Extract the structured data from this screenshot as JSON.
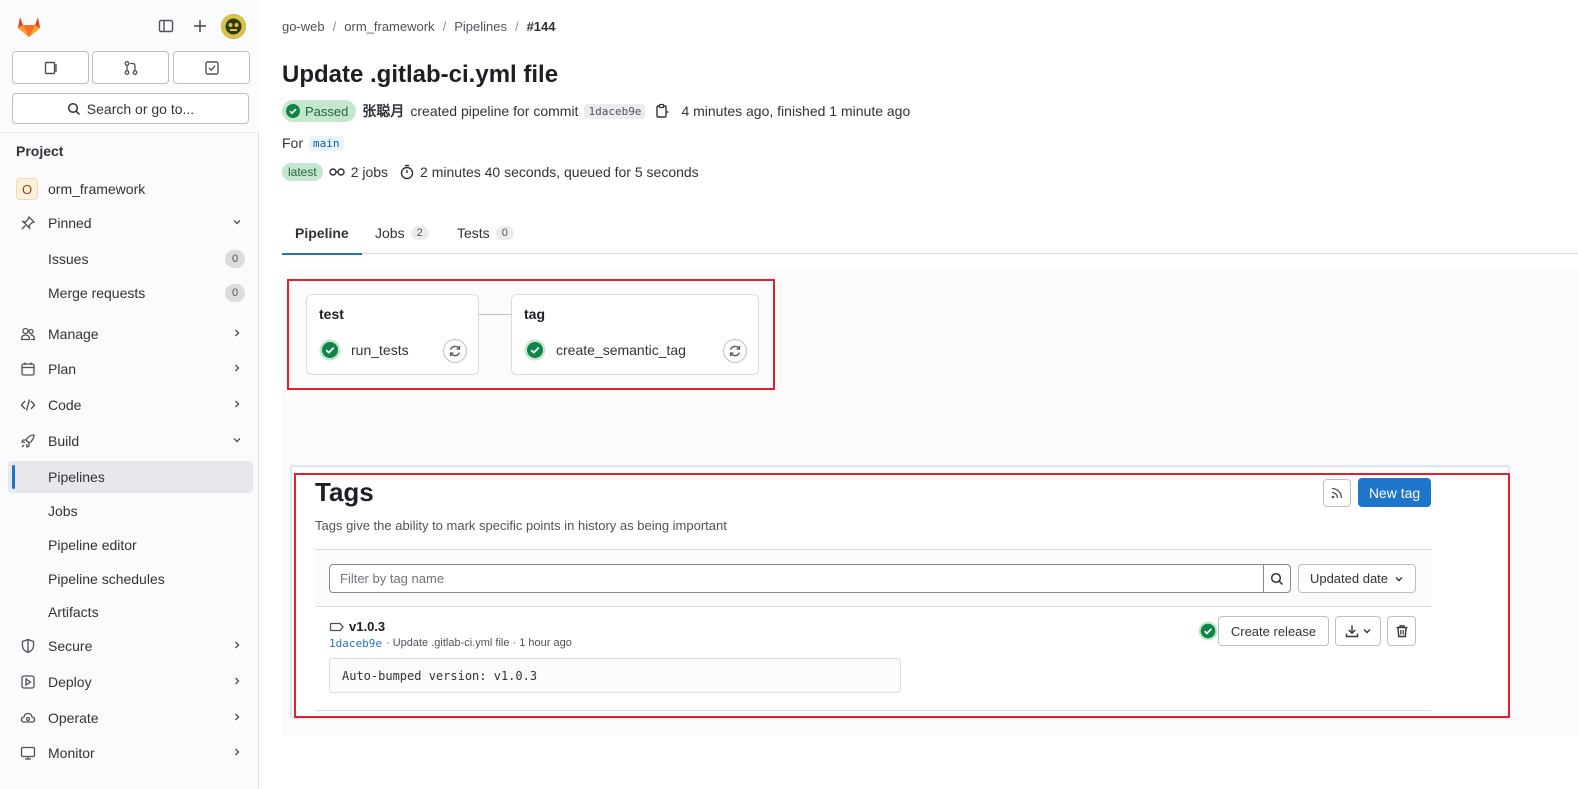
{
  "sidebar": {
    "search_label": "Search or go to...",
    "section_title": "Project",
    "project_initial": "O",
    "project_name": "orm_framework",
    "pinned_label": "Pinned",
    "issues_label": "Issues",
    "issues_count": "0",
    "mr_label": "Merge requests",
    "mr_count": "0",
    "manage": "Manage",
    "plan": "Plan",
    "code": "Code",
    "build": "Build",
    "pipelines": "Pipelines",
    "jobs": "Jobs",
    "pipeline_editor": "Pipeline editor",
    "pipeline_schedules": "Pipeline schedules",
    "artifacts": "Artifacts",
    "secure": "Secure",
    "deploy": "Deploy",
    "operate": "Operate",
    "monitor": "Monitor"
  },
  "breadcrumb": {
    "group": "go-web",
    "project": "orm_framework",
    "section": "Pipelines",
    "current": "#144"
  },
  "pipeline": {
    "title": "Update .gitlab-ci.yml file",
    "status": "Passed",
    "author": "张聪月",
    "created_text": "created pipeline for commit",
    "commit_sha": "1daceb9e",
    "time_text": "4 minutes ago, finished 1 minute ago",
    "for_label": "For",
    "branch": "main",
    "latest_badge": "latest",
    "jobs_count_text": "2 jobs",
    "duration_text": "2 minutes 40 seconds, queued for 5 seconds"
  },
  "tabs": {
    "pipeline": "Pipeline",
    "jobs": "Jobs",
    "jobs_count": "2",
    "tests": "Tests",
    "tests_count": "0"
  },
  "stages": [
    {
      "name": "test",
      "job": "run_tests"
    },
    {
      "name": "tag",
      "job": "create_semantic_tag"
    }
  ],
  "tags": {
    "title": "Tags",
    "description": "Tags give the ability to mark specific points in history as being important",
    "new_tag": "New tag",
    "filter_placeholder": "Filter by tag name",
    "sort_label": "Updated date",
    "tag_name": "v1.0.3",
    "tag_sha": "1daceb9e",
    "tag_commit_msg": "· Update .gitlab-ci.yml file · 1 hour ago",
    "tag_message": "Auto-bumped version: v1.0.3",
    "create_release": "Create release"
  },
  "colors": {
    "accent": "#1f75cb",
    "success": "#108548",
    "highlight": "#e0202b"
  }
}
